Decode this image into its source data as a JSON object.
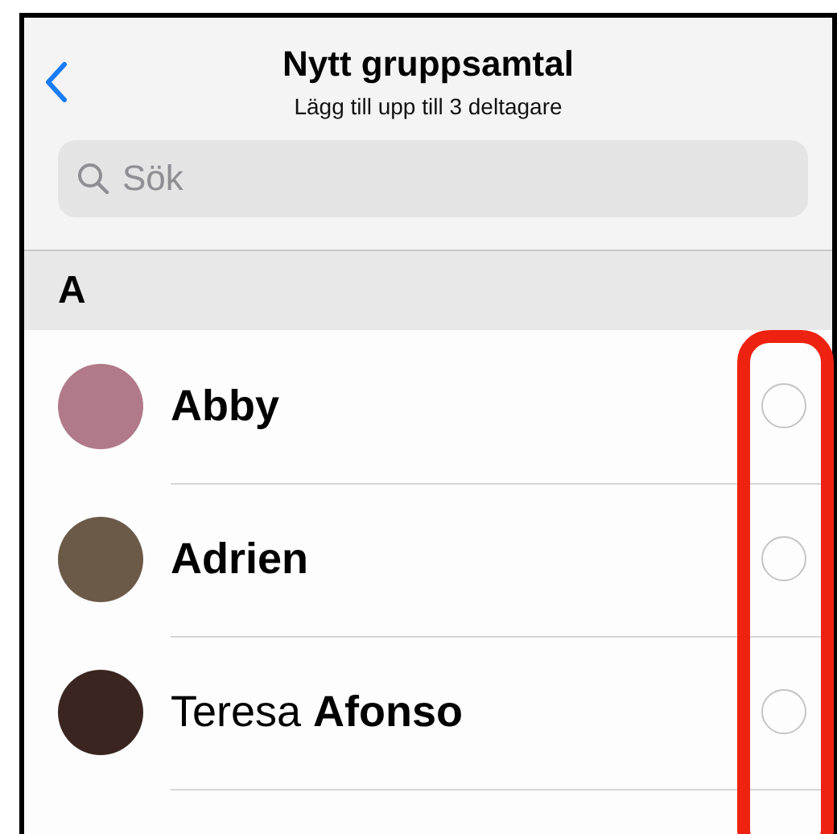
{
  "header": {
    "title": "Nytt gruppsamtal",
    "subtitle": "Lägg till upp till 3 deltagare"
  },
  "search": {
    "placeholder": "Sök"
  },
  "section": {
    "letter": "A"
  },
  "contacts": [
    {
      "family": "Abby",
      "selected": false
    },
    {
      "family": "Adrien",
      "selected": false
    },
    {
      "given": "Teresa",
      "family": "Afonso",
      "selected": false
    }
  ]
}
